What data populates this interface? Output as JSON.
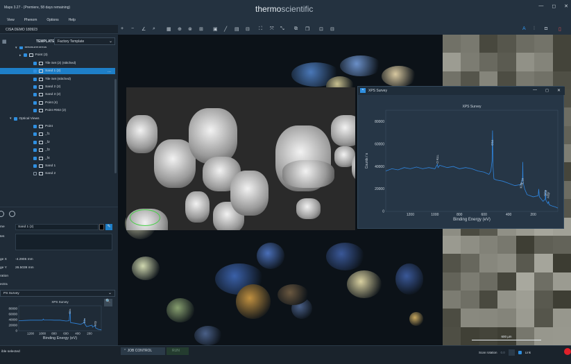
{
  "window": {
    "title": "Maps 3.27 - (Premiere, 58 days remaining)",
    "brand_a": "thermo",
    "brand_b": "scientific",
    "min": "—",
    "max": "◻",
    "close": "✕"
  },
  "menu": [
    "View",
    "Phenom",
    "Options",
    "Help"
  ],
  "project": {
    "name": "CISA DEMO 180923"
  },
  "template": {
    "label": "TEMPLATE",
    "value": "Factory Template"
  },
  "tree": [
    {
      "label": "Measurements",
      "indent": 30,
      "arrow": "▾",
      "checked": true,
      "flag": false,
      "selected": false
    },
    {
      "label": "Point (3)",
      "indent": 36,
      "arrow": "▸",
      "checked": true,
      "flag": true,
      "selected": false
    },
    {
      "label": "Tile Set (2) (stitched)",
      "indent": 48,
      "arrow": "",
      "checked": true,
      "flag": true,
      "selected": false
    },
    {
      "label": "Sand 1 (2)",
      "indent": 48,
      "arrow": "",
      "checked": true,
      "flag": true,
      "selected": true,
      "more": "..."
    },
    {
      "label": "Tile Set (stitched)",
      "indent": 48,
      "arrow": "",
      "checked": true,
      "flag": true,
      "selected": false
    },
    {
      "label": "Sand 2 (2)",
      "indent": 48,
      "arrow": "",
      "checked": true,
      "flag": true,
      "selected": false
    },
    {
      "label": "Sand 3 (2)",
      "indent": 48,
      "arrow": "",
      "checked": true,
      "flag": true,
      "selected": false
    },
    {
      "label": "Point (4)",
      "indent": 48,
      "arrow": "",
      "checked": true,
      "flag": true,
      "selected": false
    },
    {
      "label": "Point #002 (2)",
      "indent": 48,
      "arrow": "",
      "checked": true,
      "flag": true,
      "selected": false
    },
    {
      "label": "Optical Views",
      "indent": 22,
      "arrow": "▾",
      "checked": true,
      "flag": false,
      "selected": false
    },
    {
      "label": "Point",
      "indent": 48,
      "arrow": "",
      "checked": true,
      "flag": true,
      "selected": false
    },
    {
      "label": "_f1",
      "indent": 48,
      "arrow": "",
      "checked": true,
      "flag": true,
      "selected": false
    },
    {
      "label": "_f2",
      "indent": 48,
      "arrow": "",
      "checked": true,
      "flag": true,
      "selected": false
    },
    {
      "label": "_f3",
      "indent": 48,
      "arrow": "",
      "checked": true,
      "flag": true,
      "selected": false
    },
    {
      "label": "_f4",
      "indent": 48,
      "arrow": "",
      "checked": true,
      "flag": true,
      "selected": false
    },
    {
      "label": "Sand 1",
      "indent": 48,
      "arrow": "",
      "checked": true,
      "flag": true,
      "selected": false
    },
    {
      "label": "Sand 2",
      "indent": 48,
      "arrow": "",
      "checked": false,
      "flag": true,
      "selected": false
    }
  ],
  "props": {
    "name_label": "me",
    "name_value": "Sand 1 (2)",
    "notes_label": "tes",
    "stage_x_label": "ge X",
    "stage_x_value": "-4.2905 mm",
    "stage_y_label": "ge Y",
    "stage_y_value": "26.5039 mm",
    "rotation_label": "ration",
    "spectra_label": "ectra",
    "spectrum_select": "PS Survey"
  },
  "status": {
    "left": "ible selected",
    "job_control": "JOB CONTROL",
    "run": "RUN",
    "scan_rotation": "Scan rotation",
    "value": "0.0",
    "link": "Link"
  },
  "scale_label": "600 µm",
  "xps_window": {
    "title": "XPS Survey"
  },
  "colors": {
    "accent": "#1e7fc8",
    "spectrum": "#2f86e0",
    "record": "#e0202a"
  },
  "chart_data": [
    {
      "type": "line",
      "title": "XPS Survey",
      "xlabel": "Binding Energy (eV)",
      "ylabel": "Counts / s",
      "xlim": [
        1400,
        0
      ],
      "ylim": [
        0,
        90000
      ],
      "xticks": [
        1200,
        1000,
        800,
        600,
        400,
        200
      ],
      "yticks": [
        0,
        20000,
        40000,
        60000,
        80000
      ],
      "annotations": [
        {
          "label": "Si2p",
          "x": 100,
          "y": 13000
        },
        {
          "label": "Al2p",
          "x": 75,
          "y": 11000
        },
        {
          "label": "C1s",
          "x": 285,
          "y": 24000
        },
        {
          "label": "K2p",
          "x": 295,
          "y": 20000
        },
        {
          "label": "O1s",
          "x": 531,
          "y": 58000
        },
        {
          "label": "O KLL",
          "x": 978,
          "y": 42000
        }
      ],
      "x": [
        1400,
        1350,
        1300,
        1250,
        1200,
        1150,
        1100,
        1050,
        1000,
        980,
        975,
        960,
        900,
        850,
        800,
        750,
        700,
        650,
        600,
        560,
        545,
        535,
        531,
        527,
        520,
        500,
        450,
        400,
        350,
        300,
        287,
        285,
        283,
        270,
        250,
        200,
        160,
        155,
        150,
        120,
        103,
        100,
        97,
        80,
        75,
        70,
        50,
        20,
        0
      ],
      "y": [
        36000,
        38000,
        37000,
        39000,
        38000,
        39500,
        38000,
        39000,
        38000,
        42000,
        39000,
        41000,
        39000,
        40000,
        38000,
        39000,
        38000,
        36000,
        35000,
        33000,
        36000,
        45000,
        72000,
        40000,
        29000,
        28000,
        27000,
        25000,
        23000,
        24000,
        30000,
        44000,
        26000,
        20000,
        15000,
        13000,
        14000,
        20000,
        13000,
        9000,
        11000,
        19000,
        10000,
        7000,
        9000,
        6000,
        5000,
        4000,
        3000
      ]
    },
    {
      "type": "line",
      "title": "XPS Survey",
      "xlabel": "Binding Energy (eV)",
      "ylabel": "",
      "xlim": [
        1400,
        0
      ],
      "ylim": [
        0,
        90000
      ],
      "xticks": [
        1200,
        1000,
        800,
        600,
        400,
        200
      ],
      "yticks": [
        0,
        20000,
        40000,
        60000,
        80000
      ],
      "annotations": [
        {
          "label": "O1s",
          "x": 531,
          "y": 58000
        },
        {
          "label": "C1s",
          "x": 285,
          "y": 24000
        },
        {
          "label": "Si2p",
          "x": 100,
          "y": 13000
        }
      ],
      "x": [
        1400,
        1300,
        1200,
        1100,
        1000,
        980,
        975,
        900,
        800,
        700,
        600,
        545,
        531,
        520,
        450,
        350,
        287,
        285,
        283,
        250,
        155,
        150,
        100,
        97,
        50,
        0
      ],
      "y": [
        36000,
        37000,
        38000,
        38000,
        38000,
        42000,
        39000,
        39000,
        38000,
        38000,
        35000,
        36000,
        72000,
        29000,
        27000,
        23000,
        30000,
        44000,
        26000,
        15000,
        20000,
        13000,
        19000,
        10000,
        5000,
        3000
      ]
    }
  ]
}
